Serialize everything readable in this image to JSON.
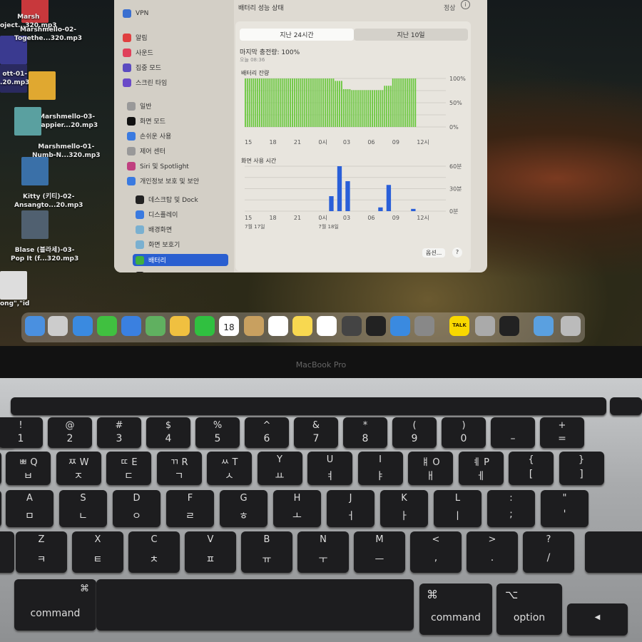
{
  "desktop": {
    "files": [
      {
        "label1": "Marsh",
        "label2": "oject...320.mp3",
        "thumb": "#c8383c"
      },
      {
        "label1": "Marshmello-02-",
        "label2": "Togethe...320.mp3",
        "thumb": "#3a3a90"
      },
      {
        "label1": "ott-01-",
        "label2": ".20.mp3",
        "thumb": "#2a2a60"
      },
      {
        "label1": "Marshmello-03-",
        "label2": "Happier...20.mp3",
        "thumb": "#e0a830"
      },
      {
        "label1": "Marshmello-01-",
        "label2": "Numb-N...320.mp3",
        "thumb": "#5aa0a0"
      },
      {
        "label1": "Kitty (키티)-02-",
        "label2": "Ansangto...20.mp3",
        "thumb": "#3a70a8"
      },
      {
        "label1": "Blase (블라세)-03-",
        "label2": "Pop It (f...320.mp3",
        "thumb": "#506070"
      },
      {
        "label1": "ong\",\"id",
        "label2": "",
        "thumb": "#ddd"
      }
    ]
  },
  "settings": {
    "sidebar": [
      {
        "label": "VPN",
        "color": "#3a6fd0"
      },
      {
        "label": "알림",
        "color": "#e04040"
      },
      {
        "label": "사운드",
        "color": "#e0405a"
      },
      {
        "label": "집중 모드",
        "color": "#5a4ac0"
      },
      {
        "label": "스크린 타임",
        "color": "#6a4ac8"
      },
      {
        "label": "일반",
        "color": "#999"
      },
      {
        "label": "화면 모드",
        "color": "#111"
      },
      {
        "label": "손쉬운 사용",
        "color": "#3a7ae0"
      },
      {
        "label": "제어 센터",
        "color": "#999"
      },
      {
        "label": "Siri 및 Spotlight",
        "color": "#c04080"
      },
      {
        "label": "개인정보 보호 및 보안",
        "color": "#3a7ae0"
      },
      {
        "label": "데스크탑 및 Dock",
        "color": "#222"
      },
      {
        "label": "디스플레이",
        "color": "#3a7ae0"
      },
      {
        "label": "배경화면",
        "color": "#7ab0d0"
      },
      {
        "label": "화면 보호기",
        "color": "#7ab0d0"
      },
      {
        "label": "배터리",
        "color": "#40b040",
        "selected": true
      },
      {
        "label": "잠금 화면",
        "color": "#222"
      }
    ],
    "health_label": "배터리 성능 상태",
    "health_value": "정상",
    "tabs": [
      "지난 24시간",
      "지난 10일"
    ],
    "last_charge": "마지막 충전량: 100%",
    "last_charge_time": "오늘 08:36",
    "options_button": "옵션...",
    "help_button": "?"
  },
  "chart_data": [
    {
      "type": "bar",
      "title": "배터리 잔량",
      "categories": [
        "15",
        "16",
        "17",
        "18",
        "19",
        "20",
        "21",
        "22",
        "23",
        "0시",
        "01",
        "02",
        "03",
        "04",
        "05",
        "06",
        "07",
        "08",
        "09",
        "10",
        "11"
      ],
      "values": [
        100,
        100,
        100,
        100,
        100,
        100,
        100,
        100,
        100,
        100,
        100,
        95,
        78,
        76,
        76,
        76,
        76,
        85,
        100,
        100,
        100
      ],
      "xticks": [
        "15",
        "18",
        "21",
        "0시",
        "03",
        "06",
        "09",
        "12시"
      ],
      "yticks": [
        "100%",
        "50%",
        "0%"
      ],
      "ylim": [
        0,
        100
      ],
      "color": "#6cc840"
    },
    {
      "type": "bar",
      "title": "화면 사용 시간",
      "categories": [
        "15",
        "16",
        "17",
        "18",
        "19",
        "20",
        "21",
        "22",
        "23",
        "0시",
        "01",
        "02",
        "03",
        "04",
        "05",
        "06",
        "07",
        "08",
        "09",
        "10",
        "11"
      ],
      "values": [
        0,
        0,
        0,
        0,
        0,
        0,
        0,
        0,
        0,
        0,
        20,
        60,
        40,
        0,
        0,
        0,
        5,
        35,
        0,
        0,
        3
      ],
      "xticks": [
        "15",
        "18",
        "21",
        "0시",
        "03",
        "06",
        "09",
        "12시"
      ],
      "yticks": [
        "60분",
        "30분",
        "0분"
      ],
      "ylim": [
        0,
        60
      ],
      "dates": [
        "7월 17일",
        "7월 18일"
      ],
      "color": "#2a5fd8"
    }
  ],
  "dock": {
    "calendar_day": "18",
    "icons": [
      {
        "name": "finder",
        "color": "#4a90e0"
      },
      {
        "name": "launchpad",
        "color": "#ccc"
      },
      {
        "name": "safari",
        "color": "#3a8ae0"
      },
      {
        "name": "messages",
        "color": "#40c040"
      },
      {
        "name": "mail",
        "color": "#3a80e0"
      },
      {
        "name": "maps",
        "color": "#60b060"
      },
      {
        "name": "photos",
        "color": "#f0c040"
      },
      {
        "name": "facetime",
        "color": "#30c040"
      },
      {
        "name": "calendar",
        "color": "#fff"
      },
      {
        "name": "contacts",
        "color": "#c8a060"
      },
      {
        "name": "reminders",
        "color": "#fff"
      },
      {
        "name": "notes",
        "color": "#f8d850"
      },
      {
        "name": "freeform",
        "color": "#fff"
      },
      {
        "name": "chess",
        "color": "#444"
      },
      {
        "name": "mission-control",
        "color": "#222"
      },
      {
        "name": "app-store",
        "color": "#3a8ae0"
      },
      {
        "name": "system-settings",
        "color": "#888"
      },
      {
        "name": "kakaotalk",
        "color": "#f8d800"
      },
      {
        "name": "utility",
        "color": "#aaa"
      },
      {
        "name": "unity",
        "color": "#222"
      },
      {
        "name": "downloads-folder",
        "color": "#5aa0e0"
      },
      {
        "name": "trash",
        "color": "#bbb"
      }
    ],
    "kakao_label": "TALK"
  },
  "laptop": {
    "brand": "MacBook Pro"
  },
  "keyboard": {
    "row1": [
      [
        "!",
        "1"
      ],
      [
        "@",
        "2"
      ],
      [
        "#",
        "3"
      ],
      [
        "$",
        "4"
      ],
      [
        "%",
        "5"
      ],
      [
        "^",
        "6"
      ],
      [
        "&",
        "7"
      ],
      [
        "*",
        "8"
      ],
      [
        "(",
        "9"
      ],
      [
        ")",
        "0"
      ],
      [
        "",
        "–"
      ],
      [
        "+",
        "="
      ]
    ],
    "row2": [
      [
        "ㅃ Q",
        "ㅂ"
      ],
      [
        "ㅉ W",
        "ㅈ"
      ],
      [
        "ㄸ E",
        "ㄷ"
      ],
      [
        "ㄲ R",
        "ㄱ"
      ],
      [
        "ㅆ T",
        "ㅅ"
      ],
      [
        "Y",
        "ㅛ"
      ],
      [
        "U",
        "ㅕ"
      ],
      [
        "I",
        "ㅑ"
      ],
      [
        "ㅒ O",
        "ㅐ"
      ],
      [
        "ㅖ P",
        "ㅔ"
      ],
      [
        "{",
        "["
      ],
      [
        "}",
        "]"
      ]
    ],
    "row3": [
      [
        "A",
        "ㅁ"
      ],
      [
        "S",
        "ㄴ"
      ],
      [
        "D",
        "ㅇ"
      ],
      [
        "F",
        "ㄹ"
      ],
      [
        "G",
        "ㅎ"
      ],
      [
        "H",
        "ㅗ"
      ],
      [
        "J",
        "ㅓ"
      ],
      [
        "K",
        "ㅏ"
      ],
      [
        "L",
        "ㅣ"
      ],
      [
        ":",
        ";"
      ],
      [
        "\"",
        "'"
      ]
    ],
    "row4": [
      [
        "Z",
        "ㅋ"
      ],
      [
        "X",
        "ㅌ"
      ],
      [
        "C",
        "ㅊ"
      ],
      [
        "V",
        "ㅍ"
      ],
      [
        "B",
        "ㅠ"
      ],
      [
        "N",
        "ㅜ"
      ],
      [
        "M",
        "ㅡ"
      ],
      [
        "<",
        ","
      ],
      [
        ">",
        "."
      ],
      [
        "?",
        "/"
      ]
    ],
    "command_symbol": "⌘",
    "command": "command",
    "option_symbol": "⌥",
    "option": "option",
    "arrow_left": "◀"
  }
}
